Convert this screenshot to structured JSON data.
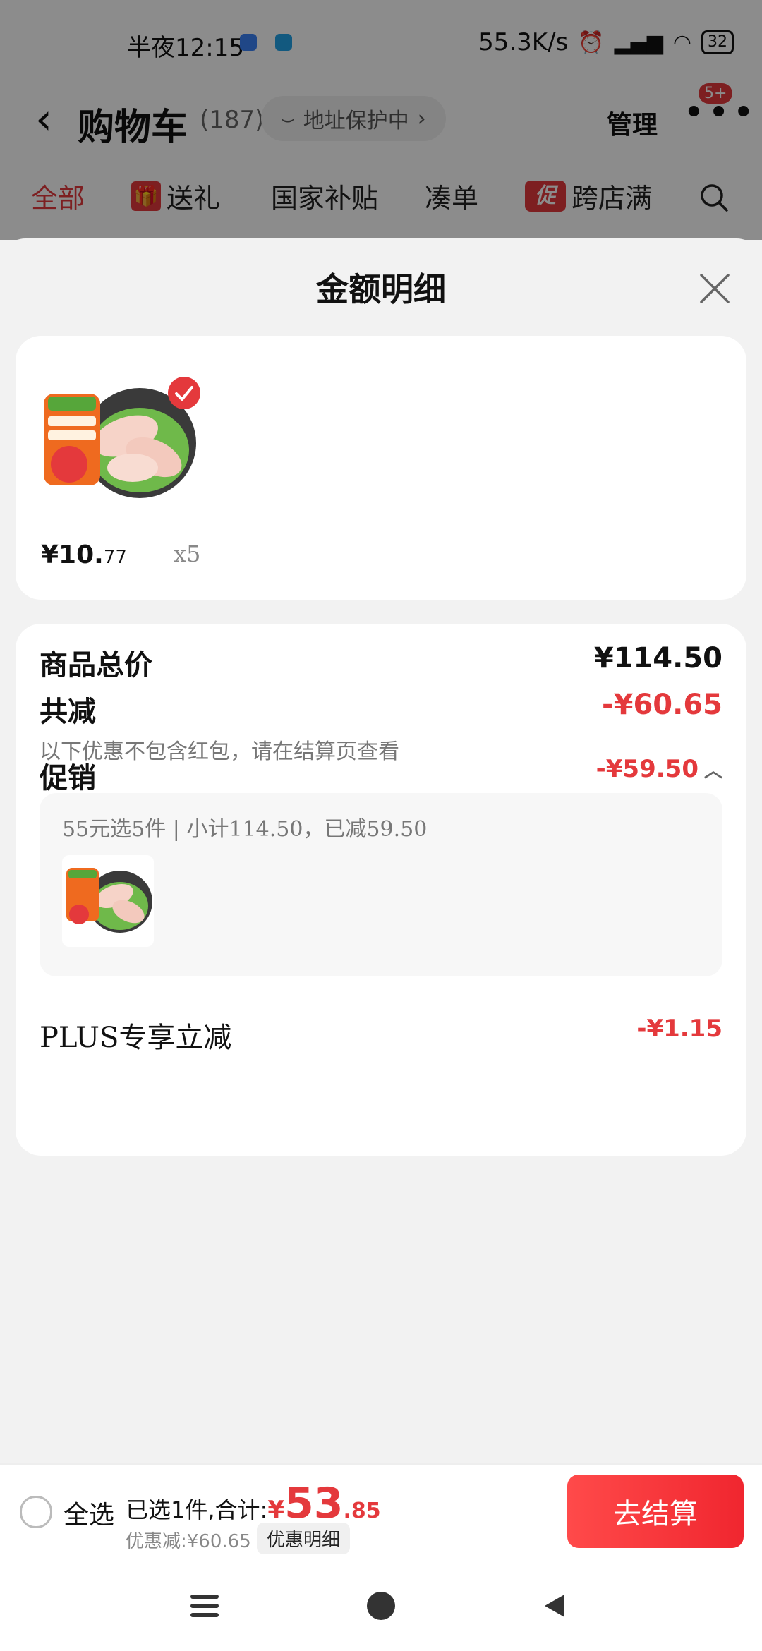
{
  "status_bar": {
    "time": "半夜12:15",
    "network_speed": "55.3K/s",
    "battery": "32"
  },
  "header": {
    "back_icon": "chevron-left-icon",
    "title": "购物车",
    "count": "(187)",
    "address_protect": "地址保护中",
    "manage": "管理",
    "more_badge": "5+"
  },
  "tabs": [
    {
      "label": "全部",
      "active": true
    },
    {
      "label": "送礼",
      "icon": "gift-icon"
    },
    {
      "label": "国家补贴"
    },
    {
      "label": "凑单"
    },
    {
      "label": "跨店满",
      "icon": "promo-icon",
      "icon_text": "促"
    }
  ],
  "sheet": {
    "title": "金额明细",
    "product": {
      "price_main": "¥10.",
      "price_decimal": "77",
      "quantity": "x5"
    },
    "total_price_label": "商品总价",
    "total_price_value": "¥114.50",
    "total_discount_label": "共减",
    "total_discount_value": "-¥60.65",
    "total_discount_note": "以下优惠不包含红包，请在结算页查看",
    "promotion_label": "促销",
    "promotion_value": "-¥59.50",
    "promotion_detail": "55元选5件 | 小计114.50，已减59.50",
    "plus_label": "PLUS专享立减",
    "plus_value": "-¥1.15"
  },
  "bottom_bar": {
    "select_all": "全选",
    "summary_prefix": "已选1件,合计:",
    "currency": "¥",
    "total_int": "53",
    "total_dec": ".85",
    "discount_text": "优惠减:¥60.65",
    "discount_detail_btn": "优惠明细",
    "checkout_btn": "去结算"
  },
  "colors": {
    "accent_red": "#e4393c",
    "overlay": "rgba(0,0,0,0.45)"
  }
}
